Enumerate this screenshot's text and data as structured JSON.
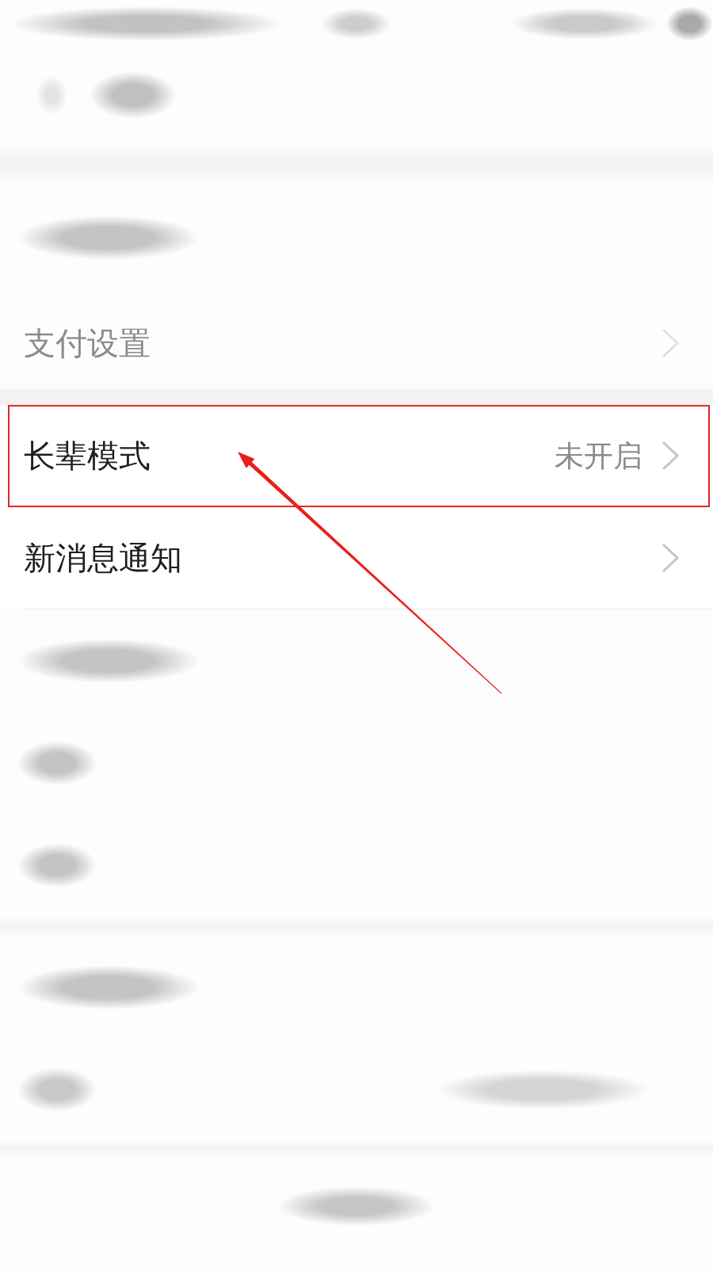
{
  "sections": [
    {
      "items": [
        {
          "kind": "blurred_long"
        },
        {
          "kind": "faded",
          "label": "支付设置"
        }
      ]
    },
    {
      "items": [
        {
          "kind": "row",
          "label": "长辈模式",
          "value": "未开启",
          "highlighted": true
        },
        {
          "kind": "row",
          "label": "新消息通知",
          "highlighted": false
        },
        {
          "kind": "blurred_long"
        },
        {
          "kind": "blurred_short"
        },
        {
          "kind": "blurred_short"
        }
      ]
    },
    {
      "items": [
        {
          "kind": "blurred_long"
        },
        {
          "kind": "blurred_detail"
        }
      ]
    }
  ]
}
